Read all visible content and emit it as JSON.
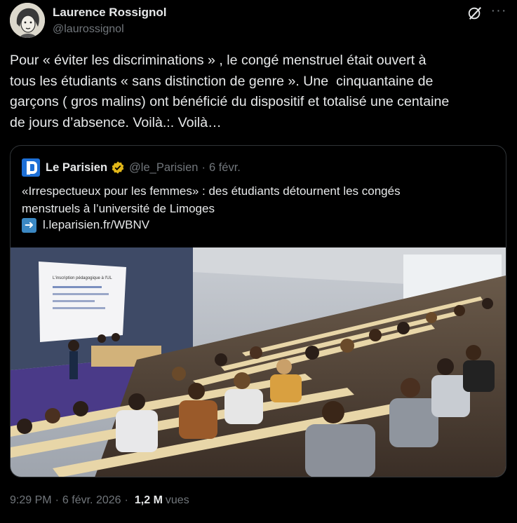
{
  "author": {
    "name": "Laurence Rossignol",
    "handle": "@laurossignol"
  },
  "tweet": {
    "text": "Pour « éviter les discriminations » , le congé menstruel était ouvert à\ntous les étudiants « sans distinction de genre ». Une  cinquantaine de\ngarçons ( gros malins) ont bénéficié du dispositif et totalisé une centaine\nde jours d’absence. Voilà.:. Voilà…"
  },
  "quote": {
    "name": "Le Parisien",
    "handle": "@le_Parisien",
    "separator": "·",
    "date": "6 févr.",
    "text": "«Irrespectueux pour les femmes» : des étudiants détournent les congés\nmenstruels à l’université de Limoges",
    "link": "l.leparisien.fr/WBNV",
    "screen_title": "L'inscription pédagogique à l'UL"
  },
  "meta": {
    "time": "9:29 PM",
    "separator": "·",
    "date": "6 févr. 2026",
    "views_count": "1,2 M",
    "views_label": "vues"
  },
  "icons": {
    "more": "more-icon",
    "grok": "grok-icon",
    "verified": "verified-badge-icon",
    "link": "right-arrow-icon"
  },
  "colors": {
    "background": "#000000",
    "text": "#e7e9ea",
    "muted": "#71767b",
    "border": "#2f3336",
    "verified_gold": "#e2b719",
    "parisien_blue": "#1d6fd6"
  }
}
